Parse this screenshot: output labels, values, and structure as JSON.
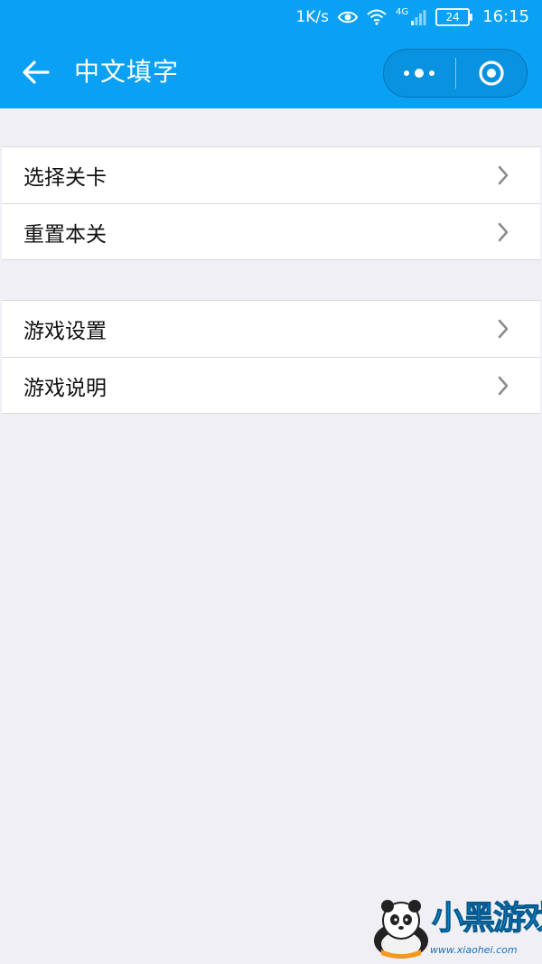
{
  "status_bar": {
    "speed": "1K/s",
    "network": "4G",
    "battery": "24",
    "time": "16:15"
  },
  "header": {
    "title": "中文填字"
  },
  "groups": [
    {
      "items": [
        {
          "label": "选择关卡"
        },
        {
          "label": "重置本关"
        }
      ]
    },
    {
      "items": [
        {
          "label": "游戏设置"
        },
        {
          "label": "游戏说明"
        }
      ]
    }
  ],
  "watermark": {
    "brand": "小黑游戏",
    "url": "www.xiaohei.com"
  },
  "colors": {
    "header_bg": "#0aa1f4",
    "page_bg": "#efeff4",
    "chevron": "#8c8c8c"
  },
  "icons": [
    "back-arrow-icon",
    "more-dots-icon",
    "close-circle-icon",
    "chevron-right-icon",
    "eye-icon",
    "wifi-icon",
    "signal-icon",
    "battery-icon"
  ]
}
